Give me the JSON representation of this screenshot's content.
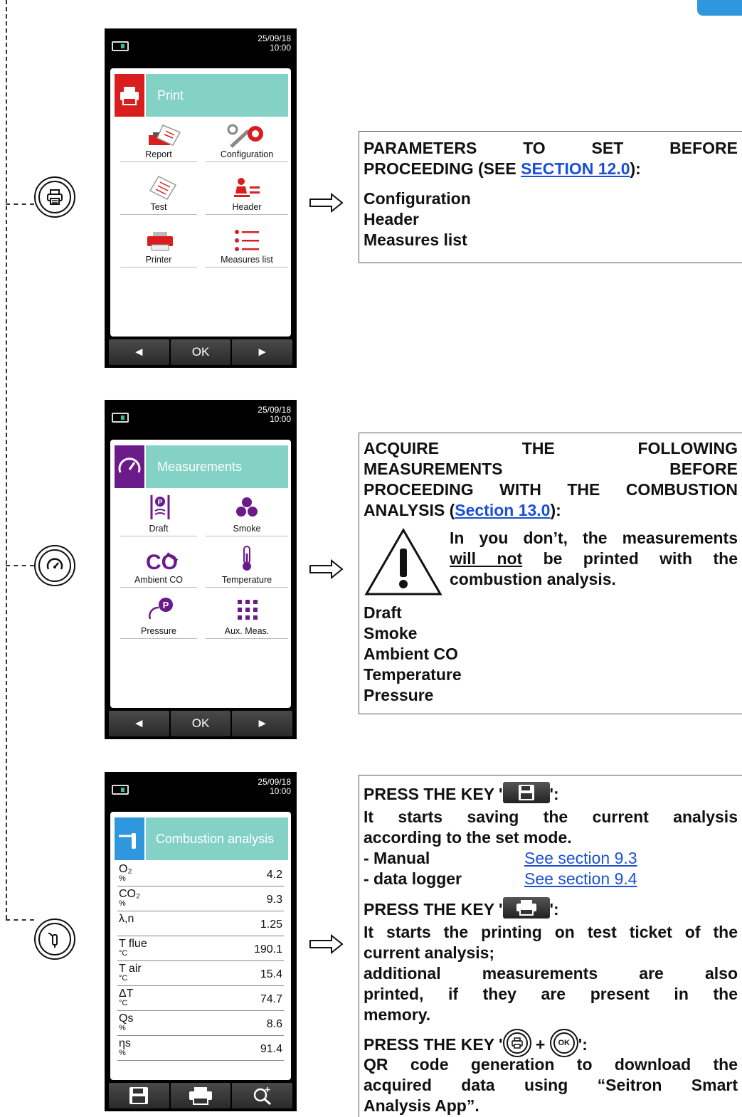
{
  "colors": {
    "accent": "#2f97dd",
    "teal": "#84d2c6",
    "print_red": "#d81e1e",
    "meas_purple": "#6b1a8a",
    "combo_blue": "#2f97dd",
    "link": "#1a4fd6"
  },
  "screens": {
    "print": {
      "date": "25/09/18",
      "time": "10:00",
      "header": {
        "title": "Print",
        "icon": "printer-icon"
      },
      "items": [
        {
          "label": "Report",
          "icon": "report-icon"
        },
        {
          "label": "Configuration",
          "icon": "configuration-icon"
        },
        {
          "label": "Test",
          "icon": "test-ticket-icon"
        },
        {
          "label": "Header",
          "icon": "header-icon"
        },
        {
          "label": "Printer",
          "icon": "printer-icon"
        },
        {
          "label": "Measures list",
          "icon": "measures-list-icon"
        }
      ],
      "softkeys": {
        "left": "◄",
        "ok": "OK",
        "right": "►"
      }
    },
    "measurements": {
      "date": "25/09/18",
      "time": "10:00",
      "header": {
        "title": "Measurements",
        "icon": "gauge-icon"
      },
      "items": [
        {
          "label": "Draft",
          "icon": "draft-icon"
        },
        {
          "label": "Smoke",
          "icon": "smoke-icon"
        },
        {
          "label": "Ambient CO",
          "icon": "co-icon"
        },
        {
          "label": "Temperature",
          "icon": "thermometer-icon"
        },
        {
          "label": "Pressure",
          "icon": "pressure-icon"
        },
        {
          "label": "Aux. Meas.",
          "icon": "grid-icon"
        }
      ],
      "softkeys": {
        "left": "◄",
        "ok": "OK",
        "right": "►"
      }
    },
    "combustion": {
      "date": "25/09/18",
      "time": "10:00",
      "header": {
        "title": "Combustion analysis",
        "icon": "probe-icon"
      },
      "rows": [
        {
          "label": "O₂",
          "unit": "%",
          "value": "4.2"
        },
        {
          "label": "CO₂",
          "unit": "%",
          "value": "9.3"
        },
        {
          "label": "λ,n",
          "unit": "",
          "value": "1.25"
        },
        {
          "label": "T flue",
          "unit": "°C",
          "value": "190.1"
        },
        {
          "label": "T air",
          "unit": "°C",
          "value": "15.4"
        },
        {
          "label": "ΔT",
          "unit": "°C",
          "value": "74.7"
        },
        {
          "label": "Qs",
          "unit": "%",
          "value": "8.6"
        },
        {
          "label": "ηs",
          "unit": "%",
          "value": "91.4"
        }
      ],
      "softkeys": [
        "save-icon",
        "printer-icon",
        "zoom-in-icon"
      ]
    }
  },
  "box1": {
    "line1": "PARAMETERS TO SET BEFORE",
    "line2_pre": "PROCEEDING (SEE ",
    "line2_link": "SECTION 12.0",
    "line2_post": "):",
    "items": [
      "Configuration",
      "Header",
      "Measures list"
    ]
  },
  "box2": {
    "line1": "ACQUIRE THE FOLLOWING",
    "line2": "MEASUREMENTS BEFORE",
    "line3": "PROCEEDING WITH THE COMBUSTION",
    "line4_pre": "ANALYSIS (",
    "line4_link": "Section 13.0",
    "line4_post": "):",
    "warn1": "In you don’t, the measurements",
    "warn2_u": "will not",
    "warn2_rest": " be printed with the",
    "warn3": "combustion analysis.",
    "items": [
      "Draft",
      "Smoke",
      "Ambient CO",
      "Temperature",
      "Pressure"
    ]
  },
  "box3": {
    "press1_pre": "PRESS THE KEY '",
    "press1_post": "':",
    "p1_l1": "It starts saving the current analysis",
    "p1_l2": "according to the set mode.",
    "manual_label": "- Manual",
    "manual_link": "See section 9.3",
    "logger_label": "- data logger",
    "logger_link": "See section 9.4",
    "press2_pre": "PRESS THE KEY '",
    "press2_post": "':",
    "p2_l1": "It starts the printing on test ticket of the",
    "p2_l2": "current analysis;",
    "p2_l3": "additional measurements are also",
    "p2_l4": "printed, if they are present in the",
    "p2_l5": "memory.",
    "press3_pre": "PRESS THE KEY '",
    "press3_plus": "+",
    "press3_post": "':",
    "ok_key": "OK",
    "p3_l1": "QR code generation to download the",
    "p3_l2": "acquired data using “Seitron Smart",
    "p3_l3": "Analysis App”."
  }
}
